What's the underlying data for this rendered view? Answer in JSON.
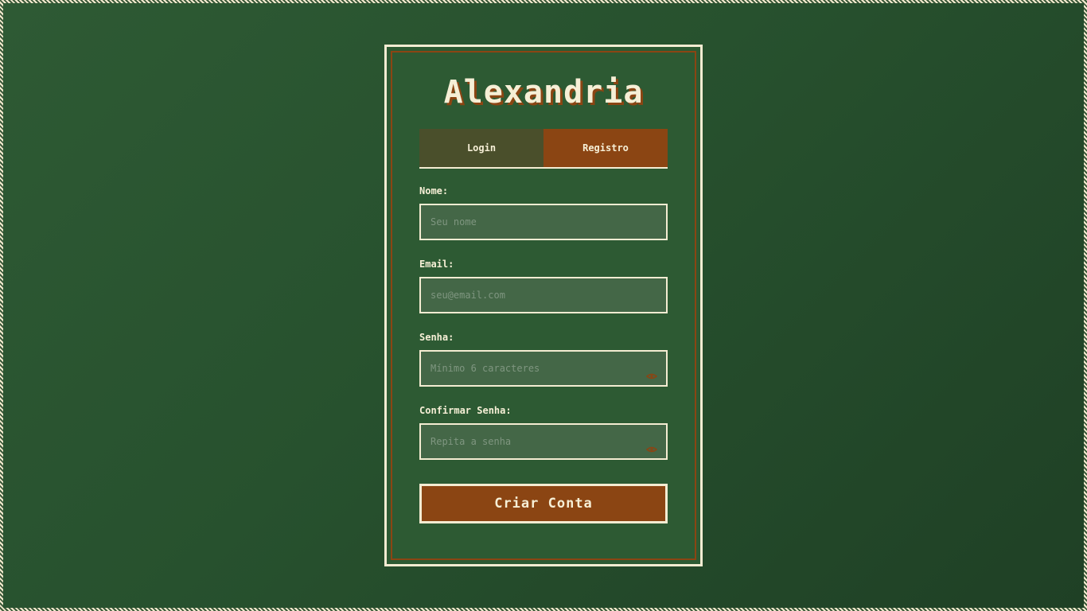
{
  "app": {
    "title": "Alexandria"
  },
  "tabs": [
    {
      "label": "Login",
      "active": false
    },
    {
      "label": "Registro",
      "active": true
    }
  ],
  "form": {
    "fields": [
      {
        "label": "Nome:",
        "placeholder": "Seu nome",
        "value": "",
        "type": "text"
      },
      {
        "label": "Email:",
        "placeholder": "seu@email.com",
        "value": "",
        "type": "email"
      },
      {
        "label": "Senha:",
        "placeholder": "Mínimo 6 caracteres",
        "value": "",
        "type": "password",
        "toggle_icon": "eye-icon"
      },
      {
        "label": "Confirmar Senha:",
        "placeholder": "Repita a senha",
        "value": "",
        "type": "password",
        "toggle_icon": "eye-icon"
      }
    ],
    "submit_label": "Criar Conta"
  },
  "colors": {
    "background": "#2a5330",
    "card": "#2d5a33",
    "accent": "#8b4513",
    "cream": "#f4ecd2",
    "tab_inactive": "#4a4f2b",
    "input_bg": "#446747"
  }
}
